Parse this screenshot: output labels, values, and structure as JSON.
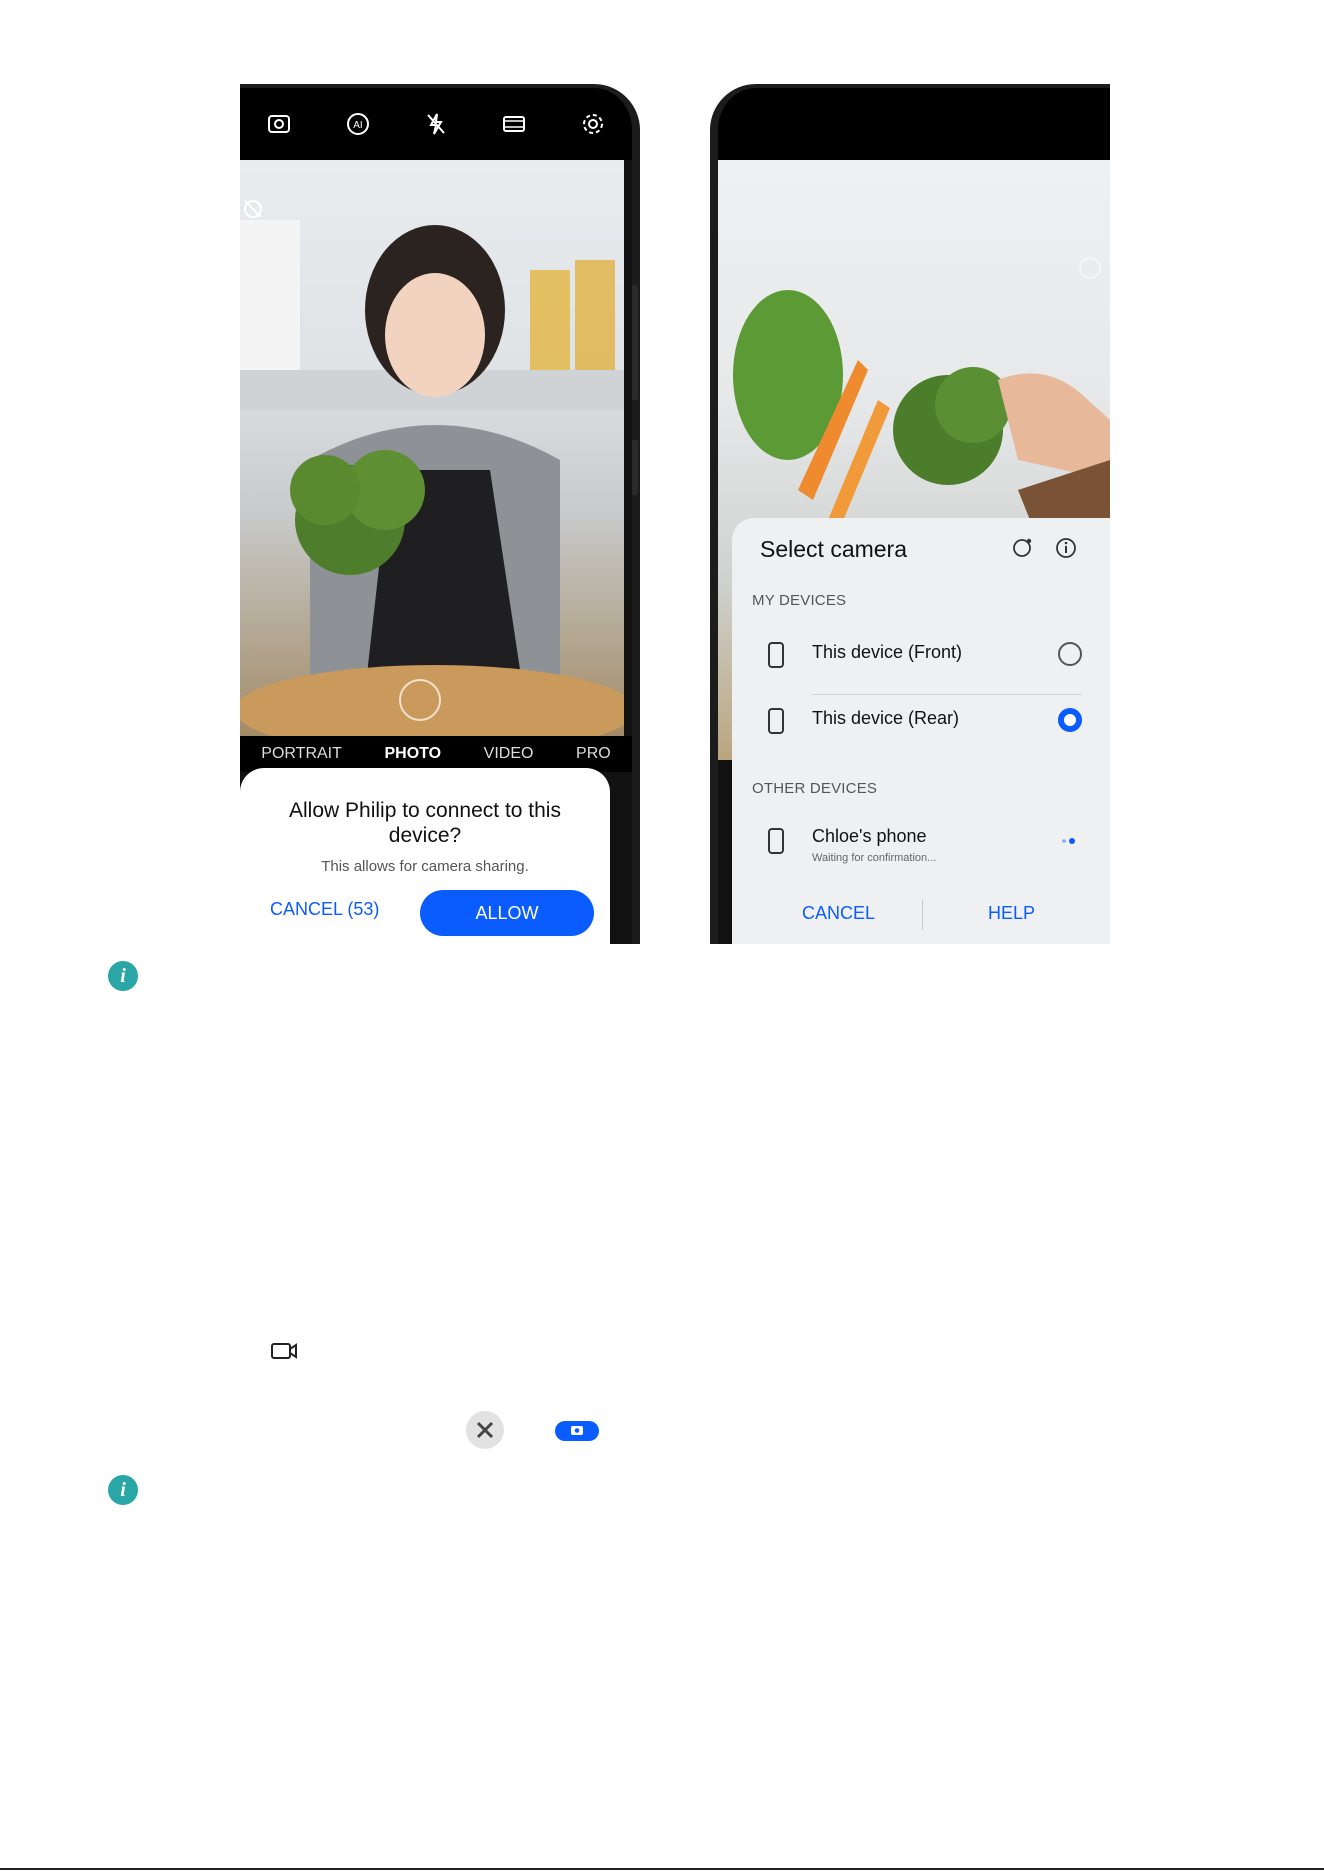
{
  "left_phone": {
    "topbar_icons": [
      "camera-switch-icon",
      "ai-icon",
      "flash-off-icon",
      "aspect-ratio-icon",
      "settings-icon"
    ],
    "modes": [
      "PORTRAIT",
      "PHOTO",
      "VIDEO",
      "PRO"
    ],
    "active_mode": "PHOTO",
    "dialog": {
      "title": "Allow Philip to connect to this device?",
      "subtitle": "This allows for camera sharing.",
      "cancel_label": "CANCEL (53)",
      "allow_label": "ALLOW"
    }
  },
  "right_phone": {
    "sheet": {
      "title": "Select camera",
      "header_icons": [
        "refresh-icon",
        "info-icon"
      ],
      "my_devices_label": "MY DEVICES",
      "my_devices": [
        {
          "label": "This device (Front)",
          "selected": false
        },
        {
          "label": "This device (Rear)",
          "selected": true
        }
      ],
      "other_devices_label": "OTHER DEVICES",
      "other_devices": [
        {
          "label": "Chloe's phone",
          "status": "Waiting for confirmation..."
        }
      ],
      "cancel_label": "CANCEL",
      "help_label": "HELP"
    }
  },
  "colors": {
    "accent": "#0a5cff",
    "info_icon": "#2aa6a6"
  }
}
